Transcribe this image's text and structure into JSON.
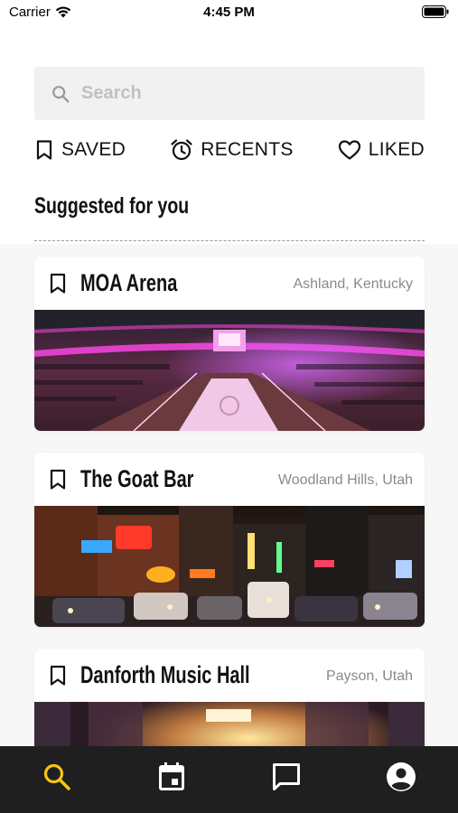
{
  "status_bar": {
    "carrier": "Carrier",
    "time": "4:45 PM"
  },
  "search": {
    "placeholder": "Search",
    "value": ""
  },
  "quick_tabs": [
    {
      "label": "SAVED",
      "icon": "bookmark-icon"
    },
    {
      "label": "RECENTS",
      "icon": "alarm-clock-icon"
    },
    {
      "label": "LIKED",
      "icon": "heart-icon"
    }
  ],
  "section": {
    "title": "Suggested for you"
  },
  "venues": [
    {
      "name": "MOA Arena",
      "location": "Ashland, Kentucky",
      "image": "arena-photo"
    },
    {
      "name": "The Goat Bar",
      "location": "Woodland Hills, Utah",
      "image": "neon-street-photo"
    },
    {
      "name": "Danforth Music Hall",
      "location": "Payson, Utah",
      "image": "concert-hall-photo"
    }
  ],
  "bottom_nav": [
    {
      "name": "search",
      "icon": "search-icon",
      "active": true
    },
    {
      "name": "calendar",
      "icon": "calendar-icon",
      "active": false
    },
    {
      "name": "messages",
      "icon": "chat-bubble-icon",
      "active": false
    },
    {
      "name": "profile",
      "icon": "account-circle-icon",
      "active": false
    }
  ],
  "colors": {
    "accent": "#f5c518",
    "nav_background": "#1f1f1f",
    "icon_inactive": "#ffffff"
  }
}
